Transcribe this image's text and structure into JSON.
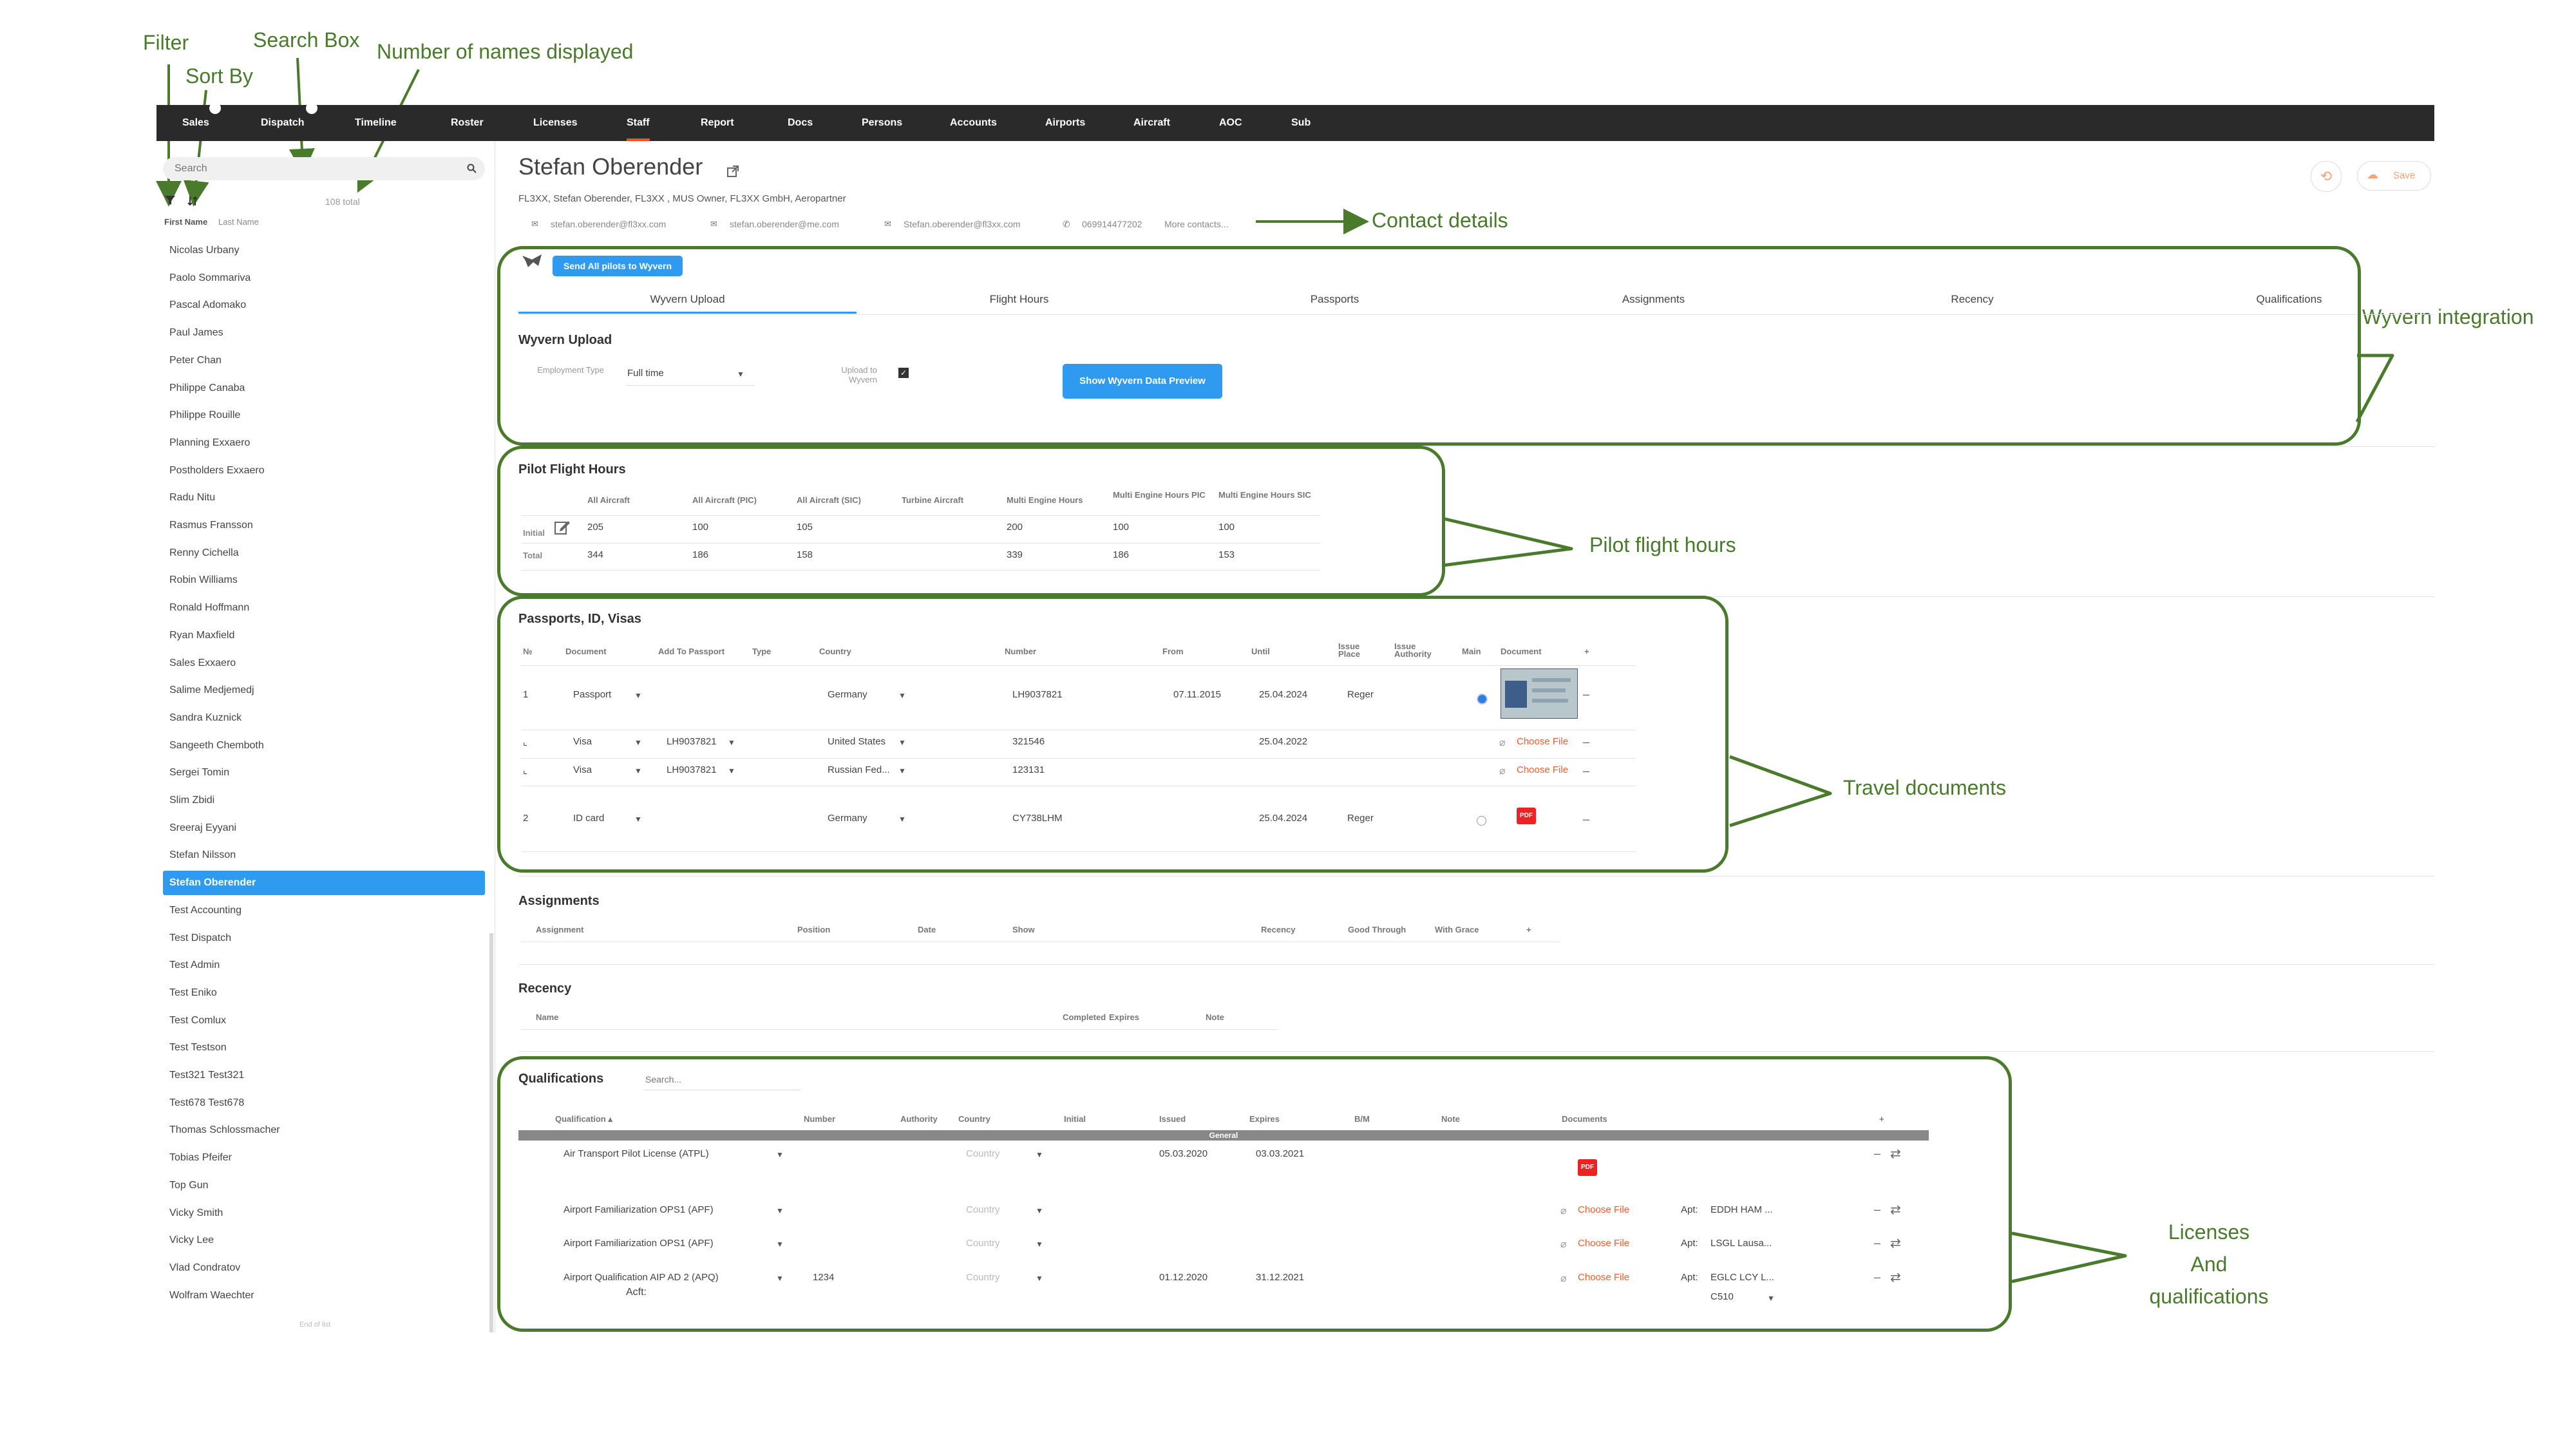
{
  "annotations": {
    "filter": "Filter",
    "sort_by": "Sort By",
    "search_box": "Search Box",
    "number_displayed": "Number of names displayed",
    "contact_details": "Contact details",
    "wyvern": "Wyvern integration",
    "flight_hours": "Pilot flight hours",
    "travel_docs": "Travel documents",
    "licenses": [
      "Licenses",
      "And",
      "qualifications"
    ]
  },
  "nav": [
    "Sales",
    "Dispatch",
    "Timeline",
    "Roster",
    "Licenses",
    "Staff",
    "Report",
    "Docs",
    "Persons",
    "Accounts",
    "Airports",
    "Aircraft",
    "AOC",
    "Sub"
  ],
  "sidebar": {
    "search_placeholder": "Search",
    "total": "108 total",
    "col_first": "First Name",
    "col_last": "Last Name",
    "people": [
      "Nicolas Urbany",
      "Paolo Sommariva",
      "Pascal Adomako",
      "Paul James",
      "Peter Chan",
      "Philippe Canaba",
      "Philippe Rouille",
      "Planning Exxaero",
      "Postholders Exxaero",
      "Radu Nitu",
      "Rasmus Fransson",
      "Renny Cichella",
      "Robin Williams",
      "Ronald Hoffmann",
      "Ryan Maxfield",
      "Sales Exxaero",
      "Salime Medjemedj",
      "Sandra Kuznick",
      "Sangeeth Chemboth",
      "Sergei Tomin",
      "Slim Zbidi",
      "Sreeraj Eyyani",
      "Stefan Nilsson",
      "Stefan Oberender",
      "Test Accounting",
      "Test Dispatch",
      "Test Admin",
      "Test Eniko",
      "Test Comlux",
      "Test Testson",
      "Test321 Test321",
      "Test678 Test678",
      "Thomas Schlossmacher",
      "Tobias Pfeifer",
      "Top Gun",
      "Vicky Smith",
      "Vicky Lee",
      "Vlad Condratov",
      "Wolfram Waechter"
    ],
    "active": "Stefan Oberender",
    "end": "End of list"
  },
  "profile": {
    "name": "Stefan Oberender",
    "roles": "FL3XX, Stefan Oberender, FL3XX , MUS Owner, FL3XX GmbH, Aeropartner",
    "email1": "stefan.oberender@fl3xx.com",
    "email2": "stefan.oberender@me.com",
    "email3": "Stefan.oberender@fl3xx.com",
    "phone": "069914477202",
    "more": "More contacts...",
    "save": "Save"
  },
  "wyvern": {
    "send_btn": "Send All pilots to Wyvern",
    "tabs": [
      "Wyvern Upload",
      "Flight Hours",
      "Passports",
      "Assignments",
      "Recency",
      "Qualifications"
    ],
    "title": "Wyvern Upload",
    "emp_label": "Employment Type",
    "emp_value": "Full time",
    "upload_label": "Upload to Wyvern",
    "preview_btn": "Show Wyvern Data Preview"
  },
  "flight_hours": {
    "title": "Pilot Flight Hours",
    "headers": [
      "All Aircraft",
      "All Aircraft (PIC)",
      "All Aircraft (SIC)",
      "Turbine Aircraft",
      "Multi Engine Hours",
      "Multi Engine Hours PIC",
      "Multi Engine Hours SIC"
    ],
    "rows": [
      {
        "label": "Initial",
        "values": [
          "205",
          "100",
          "105",
          "",
          "200",
          "100",
          "100"
        ]
      },
      {
        "label": "Total",
        "values": [
          "344",
          "186",
          "158",
          "",
          "339",
          "186",
          "153"
        ]
      }
    ]
  },
  "passports": {
    "title": "Passports, ID, Visas",
    "headers": [
      "№",
      "Document",
      "Add To Passport",
      "Type",
      "Country",
      "Number",
      "From",
      "Until",
      "Issue Place",
      "Issue Authority",
      "Main",
      "Document",
      "+"
    ],
    "rows": [
      {
        "no": "1",
        "doc": "Passport",
        "add": "",
        "country": "Germany",
        "number": "LH9037821",
        "from": "07.11.2015",
        "until": "25.04.2024",
        "place": "Reger"
      },
      {
        "no": "⌞",
        "doc": "Visa",
        "add": "LH9037821",
        "country": "United States",
        "number": "321546",
        "from": "",
        "until": "25.04.2022",
        "place": ""
      },
      {
        "no": "⌞",
        "doc": "Visa",
        "add": "LH9037821",
        "country": "Russian Fed...",
        "number": "123131",
        "from": "",
        "until": "",
        "place": ""
      },
      {
        "no": "2",
        "doc": "ID card",
        "add": "",
        "country": "Germany",
        "number": "CY738LHM",
        "from": "",
        "until": "25.04.2024",
        "place": "Reger"
      }
    ],
    "choose_file": "Choose File"
  },
  "assignments": {
    "title": "Assignments",
    "headers": [
      "Assignment",
      "Position",
      "Date",
      "Show",
      "Recency",
      "Good Through",
      "With Grace",
      "+"
    ]
  },
  "recency": {
    "title": "Recency",
    "headers": [
      "Name",
      "Completed",
      "Expires",
      "Note"
    ]
  },
  "qualifications": {
    "title": "Qualifications",
    "search_placeholder": "Search...",
    "headers": [
      "Qualification ▴",
      "Number",
      "Authority",
      "Country",
      "Initial",
      "Issued",
      "Expires",
      "B/M",
      "Note",
      "Documents",
      "+"
    ],
    "group": "General",
    "country_placeholder": "Country",
    "rows": [
      {
        "name": "Air Transport Pilot License (ATPL)",
        "number": "",
        "issued": "05.03.2020",
        "expires": "03.03.2021",
        "apt": ""
      },
      {
        "name": "Airport Familiarization OPS1 (APF)",
        "number": "",
        "issued": "",
        "expires": "",
        "apt": "EDDH HAM ..."
      },
      {
        "name": "Airport Familiarization OPS1 (APF)",
        "number": "",
        "issued": "",
        "expires": "",
        "apt": "LSGL Lausa..."
      },
      {
        "name": "Airport Qualification AIP AD 2 (APQ)",
        "number": "1234",
        "issued": "01.12.2020",
        "expires": "31.12.2021",
        "apt": "EGLC LCY L..."
      }
    ],
    "apt_label": "Apt:",
    "acft_label": "Acft:",
    "acft_value": "C510"
  }
}
